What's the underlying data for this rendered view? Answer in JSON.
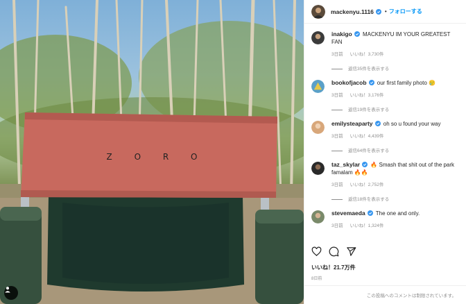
{
  "post": {
    "image_text": "Z O R O",
    "author": "mackenyu.1116",
    "separator": "•",
    "follow_label": "フォローする",
    "likes": "いいね！21.7万件",
    "time_ago": "8日前",
    "comments_disabled": "この投稿へのコメントは制限されています。"
  },
  "colors": {
    "accent": "#0095f6",
    "verified": "#3897f0",
    "chair_back": "#c8695e",
    "chair_seat": "#1f3a2e"
  },
  "comments": [
    {
      "username": "inakigo",
      "text": "MACKENYU IM YOUR GREATEST FAN",
      "time": "3日前",
      "likes": "いいね！3,730件",
      "replies": "返信35件を表示する",
      "avatar_color": "#3b3b3b"
    },
    {
      "username": "bookofjacob",
      "text": "our first family photo 🥲",
      "time": "3日前",
      "likes": "いいね！3,176件",
      "replies": "返信19件を表示する",
      "avatar_color": "#5aa0c8"
    },
    {
      "username": "emilysteaparty",
      "text": "oh so u found your way",
      "time": "3日前",
      "likes": "いいね！4,439件",
      "replies": "返信64件を表示する",
      "avatar_color": "#d8a77a"
    },
    {
      "username": "taz_skylar",
      "text": "🔥 Smash that shit out of the park famalam 🔥🔥",
      "time": "3日前",
      "likes": "いいね！2,752件",
      "replies": "返信18件を表示する",
      "avatar_color": "#2a2a2a"
    },
    {
      "username": "stevemaeda",
      "text": "The one and only.",
      "time": "3日前",
      "likes": "いいね！1,324件",
      "replies": "",
      "avatar_color": "#7a8a6a"
    }
  ],
  "icons": {
    "like": "heart-icon",
    "comment": "comment-icon",
    "share": "share-icon",
    "verified": "verified-badge-icon",
    "user_tag": "user-tag-icon"
  }
}
